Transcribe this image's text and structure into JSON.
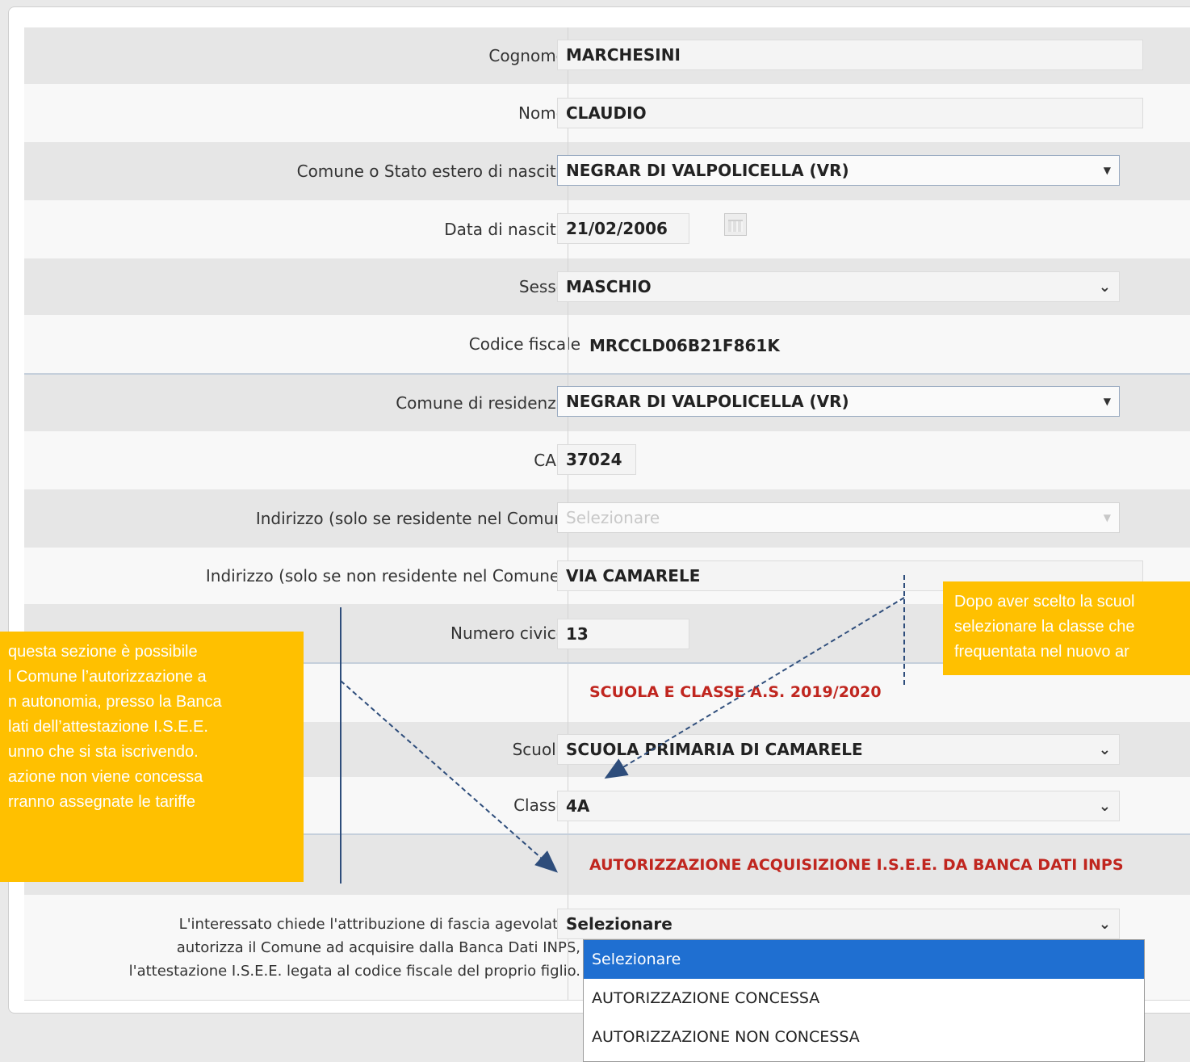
{
  "required_marker": "*",
  "rows": [
    {
      "label": "Cognome",
      "value": "MARCHESINI"
    },
    {
      "label": "Nome",
      "value": "CLAUDIO"
    },
    {
      "label": "Comune o Stato estero di nascita",
      "value": "NEGRAR DI VALPOLICELLA (VR)"
    },
    {
      "label": "Data di nascita",
      "value": "21/02/2006"
    },
    {
      "label": "Sesso",
      "value": "MASCHIO"
    },
    {
      "label": "Codice fiscale",
      "value": "MRCCLD06B21F861K"
    },
    {
      "label": "Comune di residenza",
      "value": "NEGRAR DI VALPOLICELLA (VR)"
    },
    {
      "label": "CAP",
      "value": "37024"
    },
    {
      "label": "Indirizzo (solo se residente nel Comune)",
      "value": "Selezionare"
    },
    {
      "label": "Indirizzo (solo se non residente nel Comune)",
      "value": "VIA CAMARELE"
    },
    {
      "label": "Numero civico",
      "value": "13"
    },
    {
      "heading": "SCUOLA E CLASSE A.S. 2019/2020"
    },
    {
      "label": "Scuola",
      "value": "SCUOLA PRIMARIA DI CAMARELE"
    },
    {
      "label": "Classe",
      "value": "4A"
    },
    {
      "heading": "AUTORIZZAZIONE ACQUISIZIONE I.S.E.E. DA BANCA DATI INPS"
    },
    {
      "label_lines": [
        "L'interessato chiede l'attribuzione di fascia agevolata e",
        "autorizza il Comune ad acquisire dalla Banca Dati INPS,",
        "l'attestazione I.S.E.E. legata al codice fiscale del proprio figlio."
      ],
      "value": "Selezionare"
    }
  ],
  "dropdown_options": [
    "Selezionare",
    "AUTORIZZAZIONE CONCESSA",
    "AUTORIZZAZIONE NON CONCESSA"
  ],
  "callout_left": [
    "questa sezione è possibile",
    "l Comune l’autorizzazione a",
    "n autonomia, presso la Banca",
    "lati dell’attestazione I.S.E.E.",
    "unno che si sta iscrivendo.",
    "azione non viene concessa",
    "rranno assegnate le tariffe"
  ],
  "callout_right": [
    "Dopo aver scelto la scuol",
    "selezionare la classe che",
    "frequentata nel nuovo ar"
  ],
  "colors": {
    "accent_red": "#c0261f",
    "callout": "#ffc000",
    "selected_option": "#1f6fd1",
    "arrow": "#2e4d7b"
  }
}
